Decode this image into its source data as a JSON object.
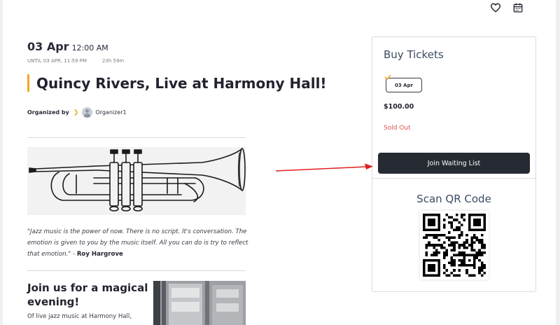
{
  "header": {
    "icons": [
      "heart-icon",
      "calendar-icon"
    ]
  },
  "event": {
    "date": "03 Apr",
    "time": "12:00 AM",
    "until": "UNTIL 03 APR, 11:59 PM",
    "duration": "23h 59m",
    "title": "Quincy Rivers, Live at Harmony Hall!",
    "organized_by_label": "Organized by",
    "organizer_name": "Organizer1"
  },
  "quote": {
    "text": "\"Jazz music is the power of now. There is no script. It's conversation. The emotion is given to you by the music itself. All you can do is try to reflect that emotion.\" - ",
    "author": "Roy Hargrove"
  },
  "section": {
    "title": "Join us for a magical evening!",
    "text": "Of live jazz music at Harmony Hall,"
  },
  "tickets": {
    "title": "Buy Tickets",
    "date_chip": "03 Apr",
    "price": "$100.00",
    "status": "Sold Out",
    "join_button": "Join Waiting List",
    "qr_title": "Scan QR Code"
  },
  "colors": {
    "accent": "#f5a623",
    "sold_out": "#d9534f",
    "button_bg": "#262a33",
    "annotation_arrow": "#e02020"
  }
}
